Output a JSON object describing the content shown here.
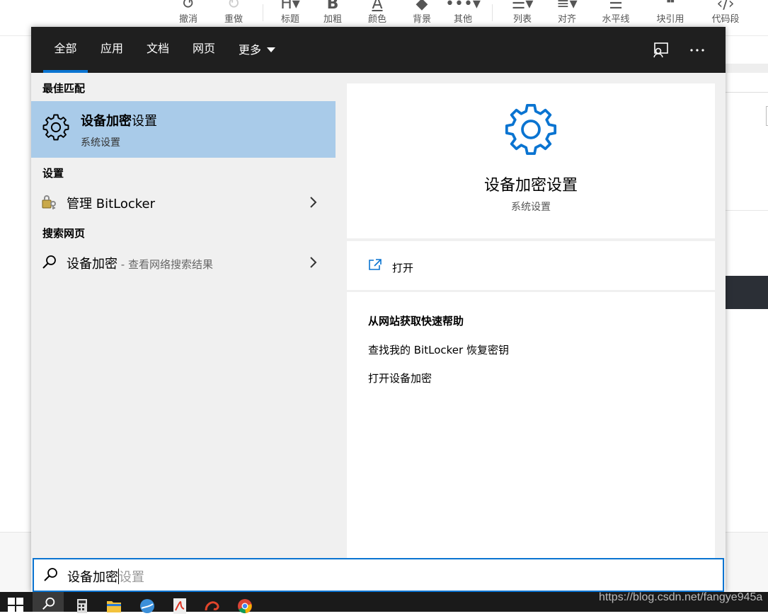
{
  "editor_toolbar": [
    {
      "id": "undo",
      "label": "撤消",
      "icon": "undo-icon"
    },
    {
      "id": "redo",
      "label": "重做",
      "icon": "redo-icon"
    },
    {
      "id": "heading",
      "label": "标题",
      "icon": "heading-icon"
    },
    {
      "id": "bold",
      "label": "加粗",
      "icon": "bold-icon"
    },
    {
      "id": "color",
      "label": "颜色",
      "icon": "font-color-icon"
    },
    {
      "id": "background",
      "label": "背景",
      "icon": "fill-icon"
    },
    {
      "id": "other",
      "label": "其他",
      "icon": "more-icon"
    },
    {
      "id": "list",
      "label": "列表",
      "icon": "list-icon"
    },
    {
      "id": "align",
      "label": "对齐",
      "icon": "align-icon"
    },
    {
      "id": "hr",
      "label": "水平线",
      "icon": "horizontal-rule-icon"
    },
    {
      "id": "quote",
      "label": "块引用",
      "icon": "quote-icon"
    },
    {
      "id": "code",
      "label": "代码段",
      "icon": "code-icon"
    }
  ],
  "search": {
    "tabs": {
      "all": "全部",
      "apps": "应用",
      "docs": "文档",
      "web": "网页",
      "more": "更多"
    },
    "active_tab": "all",
    "sections": {
      "best_match": "最佳匹配",
      "settings": "设置",
      "web": "搜索网页"
    },
    "best_match": {
      "title_bold": "设备加密",
      "title_rest": "设置",
      "subtitle": "系统设置"
    },
    "settings_item": {
      "label": "管理 BitLocker"
    },
    "web_item": {
      "label": "设备加密",
      "suffix": " - 查看网络搜索结果"
    },
    "preview": {
      "title": "设备加密设置",
      "subtitle": "系统设置",
      "open_label": "打开",
      "help_title": "从网站获取快速帮助",
      "help_links": [
        "查找我的 BitLocker 恢复密钥",
        "打开设备加密"
      ]
    },
    "query": "设备加密",
    "query_hint": "设置"
  },
  "watermark": "https://blog.csdn.net/fangye945a",
  "colors": {
    "accent": "#0a74d1",
    "header_bg": "#1f1f1f",
    "selected_bg": "#a9cbe9",
    "panel_bg": "#f0f0f0"
  }
}
